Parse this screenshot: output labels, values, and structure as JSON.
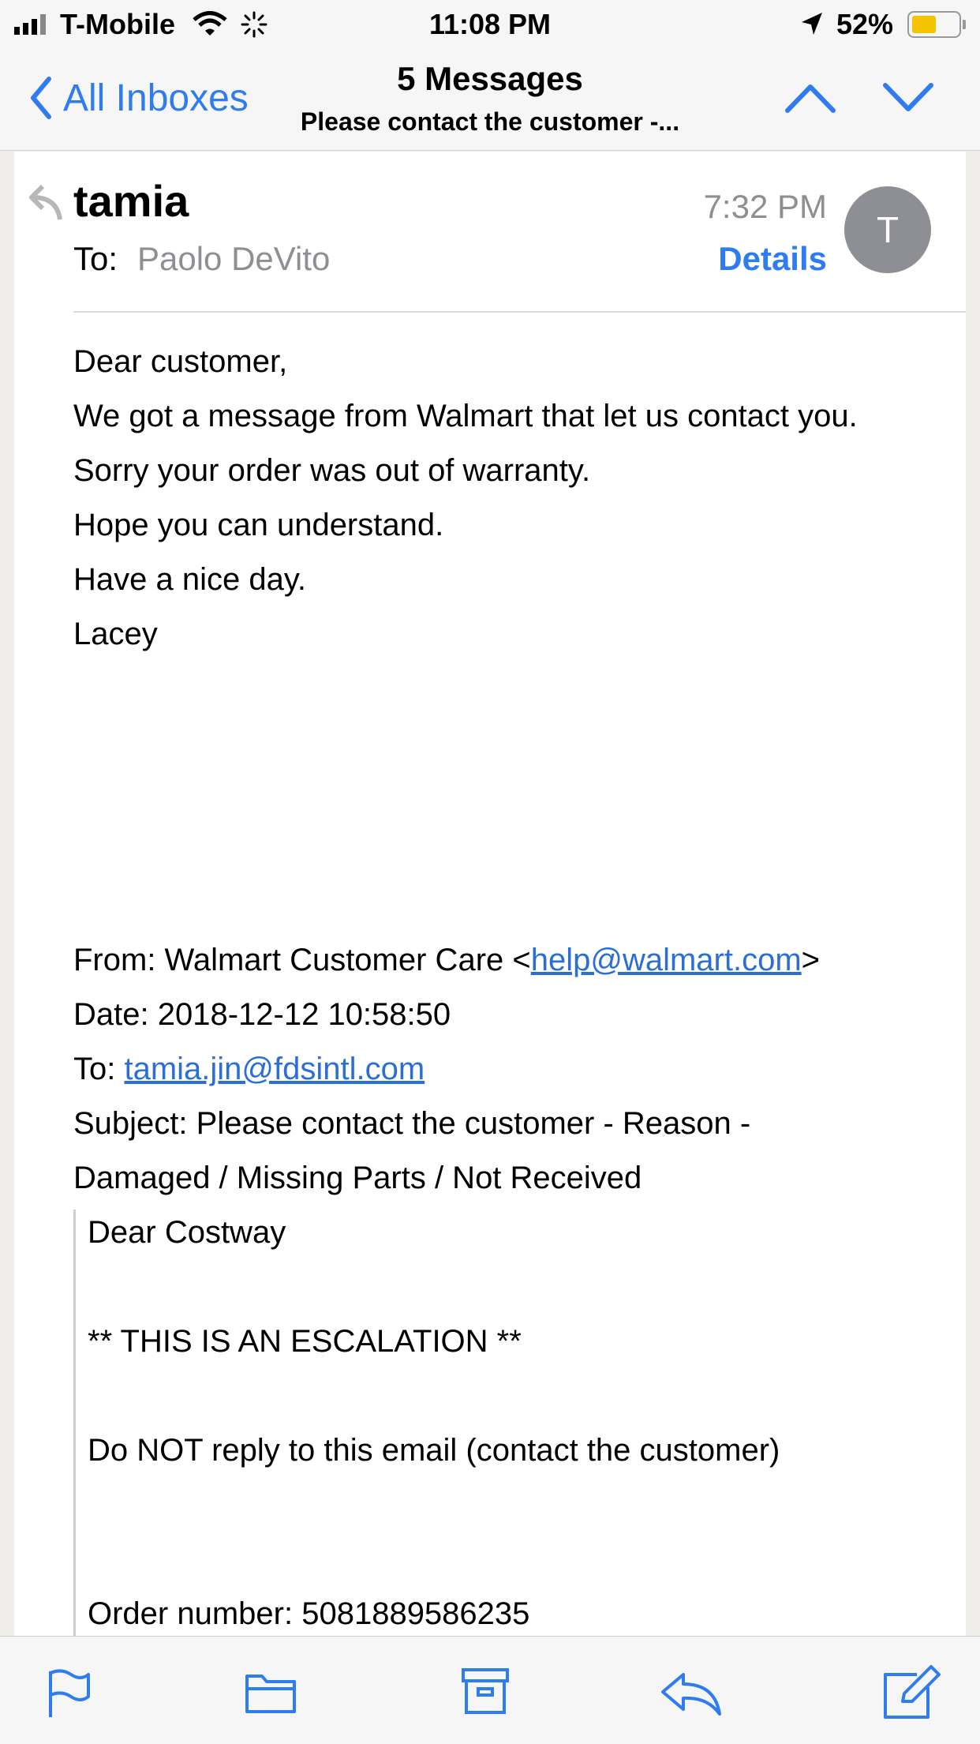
{
  "status": {
    "carrier": "T-Mobile",
    "time": "11:08 PM",
    "battery": "52%"
  },
  "nav": {
    "back_label": "All Inboxes",
    "title": "5 Messages",
    "subtitle": "Please contact the customer -..."
  },
  "message": {
    "sender": "tamia",
    "to_label": "To:",
    "to_name": "Paolo DeVito",
    "time": "7:32 PM",
    "details_label": "Details",
    "avatar_initial": "T",
    "greeting": "Dear customer,",
    "body": [
      "We got a message from Walmart that let us contact you.",
      "Sorry your order was out of warranty.",
      "Hope you can understand.",
      "Have a nice day.",
      "Lacey"
    ],
    "forward": {
      "from_label": "From: Walmart Customer Care <",
      "from_email": "help@walmart.com",
      "from_end": ">",
      "date": "Date: 2018-12-12 10:58:50",
      "to_label": "To: ",
      "to_email": "tamia.jin@fdsintl.com",
      "subject_line1": "Subject: Please contact the customer - Reason -",
      "subject_line2": "Damaged / Missing Parts / Not Received"
    },
    "quoted": [
      "Dear Costway",
      "** THIS IS AN ESCALATION **",
      "Do NOT reply to this email (contact the customer)",
      "Order number: 5081889586235"
    ]
  },
  "toolbar": {
    "icons": [
      "flag-icon",
      "folder-icon",
      "archive-icon",
      "reply-icon",
      "compose-icon"
    ]
  },
  "colors": {
    "accent": "#2f7bf0",
    "avatar": "#8e8f95"
  }
}
